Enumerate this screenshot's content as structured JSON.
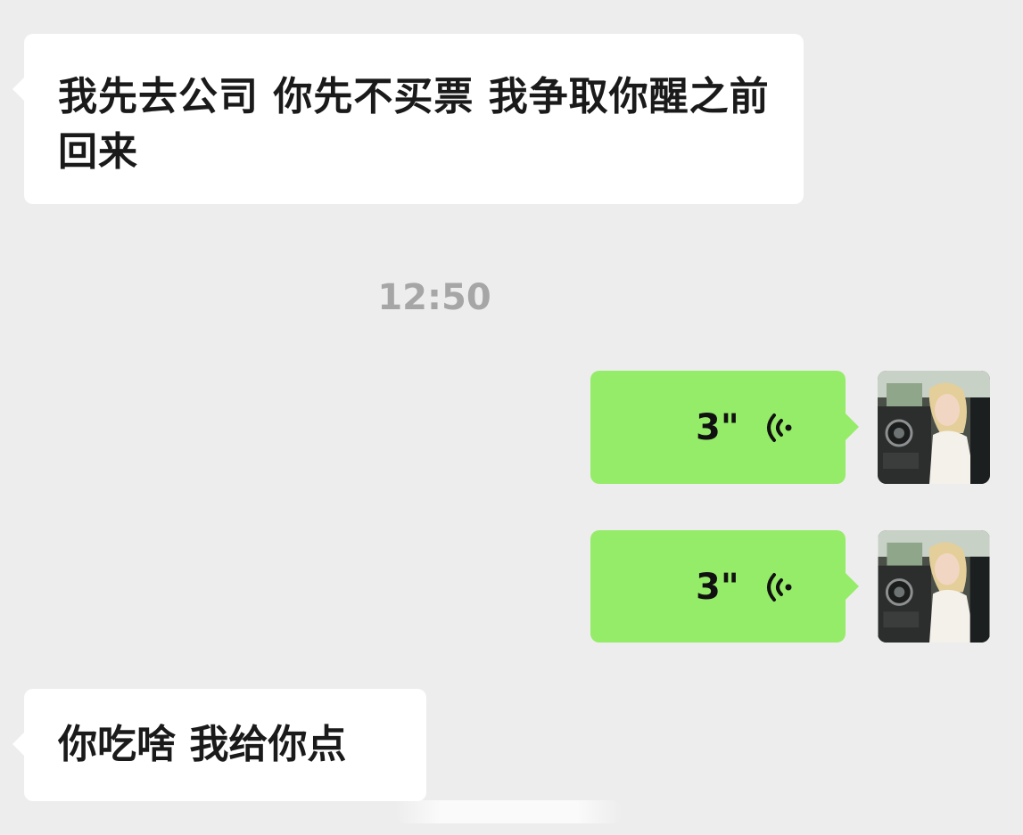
{
  "messages": [
    {
      "id": "msg-1",
      "direction": "incoming",
      "type": "text",
      "text": "我先去公司 你先不买票 我争取你醒之前回来"
    },
    {
      "id": "timestamp",
      "type": "time",
      "text": "12:50"
    },
    {
      "id": "msg-2",
      "direction": "outgoing",
      "type": "voice",
      "duration": "3\"",
      "icon": "voice-wave-icon"
    },
    {
      "id": "msg-3",
      "direction": "outgoing",
      "type": "voice",
      "duration": "3\"",
      "icon": "voice-wave-icon"
    },
    {
      "id": "msg-4",
      "direction": "incoming",
      "type": "text",
      "text": "你吃啥 我给你点"
    }
  ],
  "colors": {
    "background": "#ededed",
    "incoming_bubble": "#ffffff",
    "outgoing_bubble": "#95ec69",
    "timestamp_text": "#a6a6a6"
  }
}
